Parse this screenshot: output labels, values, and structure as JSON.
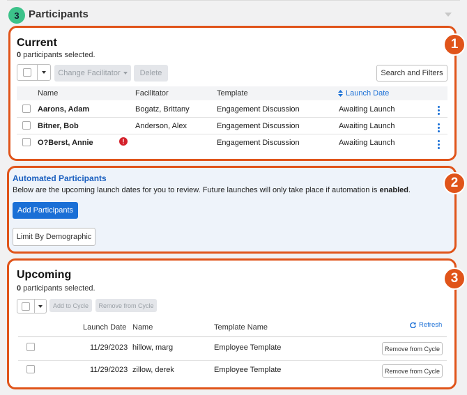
{
  "section": {
    "step": "3",
    "title": "Participants"
  },
  "callouts": [
    "1",
    "2",
    "3"
  ],
  "current": {
    "title": "Current",
    "selected_count": "0",
    "selected_suffix": " participants selected.",
    "buttons": {
      "change_facilitator": "Change Facilitator",
      "delete": "Delete",
      "search_filters": "Search and Filters"
    },
    "columns": {
      "name": "Name",
      "facilitator": "Facilitator",
      "template": "Template",
      "launch_date": "Launch Date"
    },
    "rows": [
      {
        "name": "Aarons, Adam",
        "facilitator": "Bogatz, Brittany",
        "template": "Engagement Discussion",
        "launch": "Awaiting Launch"
      },
      {
        "name": "Bitner, Bob",
        "facilitator": "Anderson, Alex",
        "template": "Engagement Discussion",
        "launch": "Awaiting Launch"
      },
      {
        "name": "O?Berst, Annie",
        "facilitator": "",
        "template": "Engagement Discussion",
        "launch": "Awaiting Launch",
        "alert": "!"
      }
    ]
  },
  "automated": {
    "title": "Automated Participants",
    "description": "Below are the upcoming launch dates for you to review. Future launches will only take place if automation is ",
    "description_bold": "enabled",
    "description_end": ".",
    "add_button": "Add Participants",
    "limit_button": "Limit By Demographic"
  },
  "upcoming": {
    "title": "Upcoming",
    "selected_count": "0",
    "selected_suffix": " participants selected.",
    "buttons": {
      "add_to_cycle": "Add to Cycle",
      "remove_from_cycle": "Remove from Cycle"
    },
    "refresh": "Refresh",
    "columns": {
      "launch_date": "Launch Date",
      "name": "Name",
      "template_name": "Template Name"
    },
    "rows": [
      {
        "launch": "11/29/2023",
        "name": "hillow, marg",
        "template": "Employee Template",
        "action": "Remove from Cycle"
      },
      {
        "launch": "11/29/2023",
        "name": "zillow, derek",
        "template": "Employee Template",
        "action": "Remove from Cycle"
      }
    ]
  },
  "colors": {
    "accent": "#1a6fd6",
    "callout": "#e0541a",
    "badge": "#3cc28a",
    "alert": "#d4202a"
  },
  "icons": {
    "sort": "sort-icon",
    "kebab": "kebab-menu-icon",
    "refresh": "refresh-icon",
    "alert": "alert-icon",
    "caret": "chevron-down-icon"
  }
}
